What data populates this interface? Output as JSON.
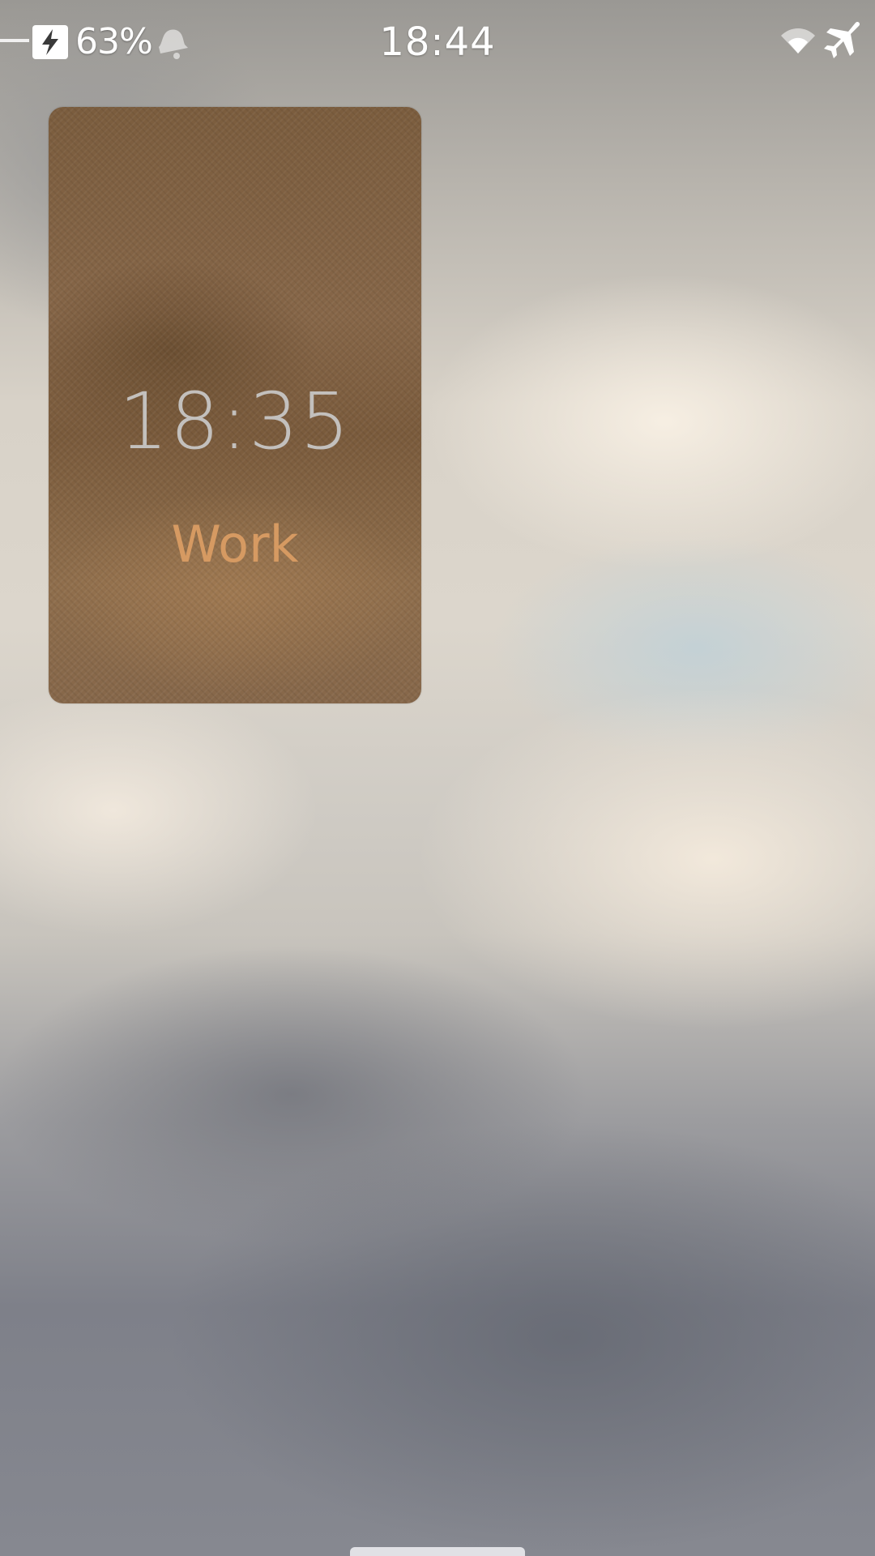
{
  "status_bar": {
    "battery_percent": "63%",
    "time": "18:44",
    "icons": [
      "charger-icon",
      "battery-charging-icon",
      "bell-icon",
      "wifi-icon",
      "airplane-mode-icon"
    ]
  },
  "cover": {
    "time": "18:35",
    "label": "Work",
    "colors": {
      "time_text": "#c3c0bd",
      "label_text": "#d69a62",
      "background": "#866648"
    }
  }
}
